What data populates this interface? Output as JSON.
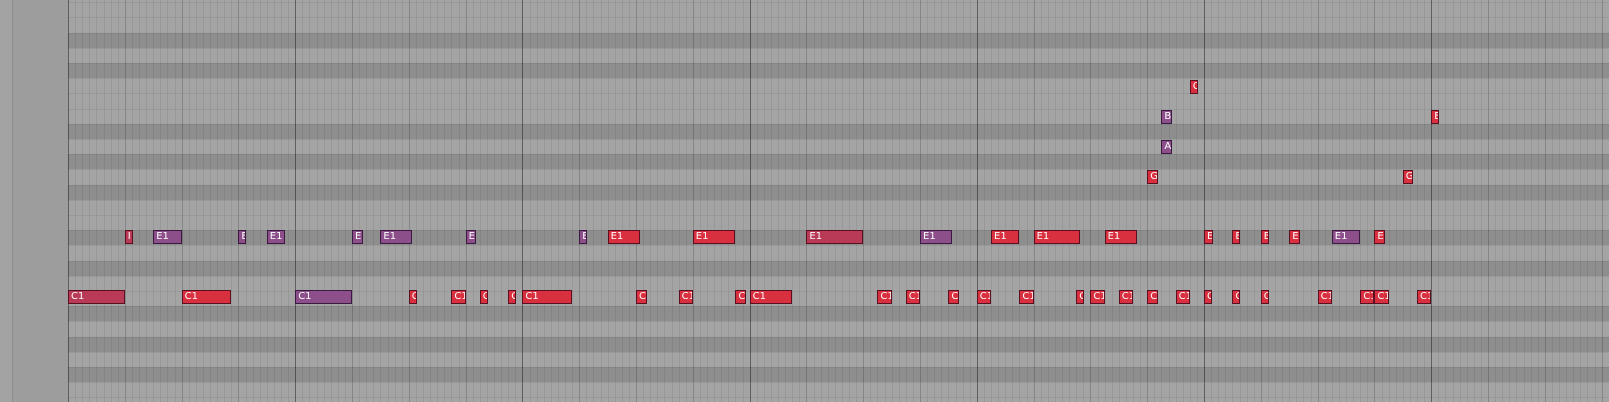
{
  "colors": {
    "red": "#d9303f",
    "rose": "#b83a57",
    "purple": "#8c4f8a"
  },
  "pitches": {
    "C": "C1",
    "E": "E1",
    "G": "G",
    "A": "A",
    "B": "B",
    "C2": "C",
    "E2": "E"
  },
  "notes": [
    {
      "pitch": "C",
      "label": "C1",
      "start": 0,
      "len": 8,
      "color": "rose"
    },
    {
      "pitch": "C",
      "label": "C1",
      "start": 16,
      "len": 7,
      "color": "red"
    },
    {
      "pitch": "C",
      "label": "C1",
      "start": 32,
      "len": 8,
      "color": "purple"
    },
    {
      "pitch": "C",
      "label": "C",
      "start": 48,
      "len": 1,
      "color": "red"
    },
    {
      "pitch": "C",
      "label": "C1",
      "start": 54,
      "len": 2,
      "color": "red"
    },
    {
      "pitch": "C",
      "label": "C",
      "start": 58,
      "len": 1,
      "color": "red"
    },
    {
      "pitch": "C",
      "label": "C",
      "start": 62,
      "len": 1,
      "color": "red"
    },
    {
      "pitch": "C",
      "label": "C1",
      "start": 64,
      "len": 7,
      "color": "red"
    },
    {
      "pitch": "C",
      "label": "C1",
      "start": 80,
      "len": 1.5,
      "color": "red"
    },
    {
      "pitch": "C",
      "label": "C1",
      "start": 86,
      "len": 2,
      "color": "red"
    },
    {
      "pitch": "C",
      "label": "C",
      "start": 94,
      "len": 1.5,
      "color": "red"
    },
    {
      "pitch": "C",
      "label": "C1",
      "start": 96,
      "len": 6,
      "color": "red"
    },
    {
      "pitch": "C",
      "label": "C1",
      "start": 114,
      "len": 2,
      "color": "red"
    },
    {
      "pitch": "C",
      "label": "C1",
      "start": 118,
      "len": 2,
      "color": "red"
    },
    {
      "pitch": "C",
      "label": "C",
      "start": 124,
      "len": 1.5,
      "color": "red"
    },
    {
      "pitch": "C",
      "label": "C1",
      "start": 128,
      "len": 2,
      "color": "red"
    },
    {
      "pitch": "C",
      "label": "C1",
      "start": 134,
      "len": 2,
      "color": "red"
    },
    {
      "pitch": "C",
      "label": "C",
      "start": 142,
      "len": 1,
      "color": "red"
    },
    {
      "pitch": "C",
      "label": "C1",
      "start": 144,
      "len": 2,
      "color": "red"
    },
    {
      "pitch": "C",
      "label": "C1",
      "start": 148,
      "len": 2,
      "color": "red"
    },
    {
      "pitch": "C",
      "label": "C",
      "start": 152,
      "len": 1.5,
      "color": "red"
    },
    {
      "pitch": "C",
      "label": "C1",
      "start": 156,
      "len": 2,
      "color": "red"
    },
    {
      "pitch": "C",
      "label": "C",
      "start": 160,
      "len": 1,
      "color": "red"
    },
    {
      "pitch": "C",
      "label": "C",
      "start": 164,
      "len": 1,
      "color": "red"
    },
    {
      "pitch": "C",
      "label": "C",
      "start": 168,
      "len": 1,
      "color": "red"
    },
    {
      "pitch": "C",
      "label": "C1",
      "start": 176,
      "len": 2,
      "color": "red"
    },
    {
      "pitch": "C",
      "label": "C1",
      "start": 182,
      "len": 2,
      "color": "red"
    },
    {
      "pitch": "C",
      "label": "C1",
      "start": 184,
      "len": 2,
      "color": "red"
    },
    {
      "pitch": "C",
      "label": "C1",
      "start": 190,
      "len": 2,
      "color": "red"
    },
    {
      "pitch": "E",
      "label": "I",
      "start": 8,
      "len": 1,
      "color": "rose"
    },
    {
      "pitch": "E",
      "label": "E1",
      "start": 12,
      "len": 4,
      "color": "purple"
    },
    {
      "pitch": "E",
      "label": "E",
      "start": 24,
      "len": 1,
      "color": "purple"
    },
    {
      "pitch": "E",
      "label": "E1",
      "start": 28,
      "len": 2.5,
      "color": "purple"
    },
    {
      "pitch": "E",
      "label": "E",
      "start": 40,
      "len": 1.5,
      "color": "purple"
    },
    {
      "pitch": "E",
      "label": "E1",
      "start": 44,
      "len": 4.5,
      "color": "purple"
    },
    {
      "pitch": "E",
      "label": "E",
      "start": 56,
      "len": 1.5,
      "color": "purple"
    },
    {
      "pitch": "E",
      "label": "E",
      "start": 72,
      "len": 1,
      "color": "purple"
    },
    {
      "pitch": "E",
      "label": "E1",
      "start": 76,
      "len": 4.5,
      "color": "red"
    },
    {
      "pitch": "E",
      "label": "E1",
      "start": 88,
      "len": 6,
      "color": "red"
    },
    {
      "pitch": "E",
      "label": "E1",
      "start": 104,
      "len": 8,
      "color": "rose"
    },
    {
      "pitch": "E",
      "label": "E1",
      "start": 120,
      "len": 4.5,
      "color": "purple"
    },
    {
      "pitch": "E",
      "label": "E1",
      "start": 130,
      "len": 4,
      "color": "red"
    },
    {
      "pitch": "E",
      "label": "E1",
      "start": 136,
      "len": 6.5,
      "color": "red"
    },
    {
      "pitch": "E",
      "label": "E1",
      "start": 146,
      "len": 4.5,
      "color": "red"
    },
    {
      "pitch": "E",
      "label": "E",
      "start": 160,
      "len": 1.2,
      "color": "red"
    },
    {
      "pitch": "E",
      "label": "E",
      "start": 164,
      "len": 1,
      "color": "red"
    },
    {
      "pitch": "E",
      "label": "E",
      "start": 168,
      "len": 1,
      "color": "red"
    },
    {
      "pitch": "E",
      "label": "E",
      "start": 172,
      "len": 1.5,
      "color": "red"
    },
    {
      "pitch": "E",
      "label": "E1",
      "start": 178,
      "len": 4,
      "color": "purple"
    },
    {
      "pitch": "E",
      "label": "E",
      "start": 184,
      "len": 1.5,
      "color": "red"
    },
    {
      "pitch": "G",
      "label": "G",
      "start": 152,
      "len": 1.5,
      "color": "red"
    },
    {
      "pitch": "G",
      "label": "G",
      "start": 188,
      "len": 1.5,
      "color": "red"
    },
    {
      "pitch": "A",
      "label": "A",
      "start": 154,
      "len": 1.5,
      "color": "purple"
    },
    {
      "pitch": "B",
      "label": "B",
      "start": 154,
      "len": 1.5,
      "color": "purple"
    },
    {
      "pitch": "B",
      "label": "E",
      "start": 192,
      "len": 1,
      "color": "red"
    },
    {
      "pitch": "C2",
      "label": "C",
      "start": 158,
      "len": 1.2,
      "color": "red"
    }
  ]
}
